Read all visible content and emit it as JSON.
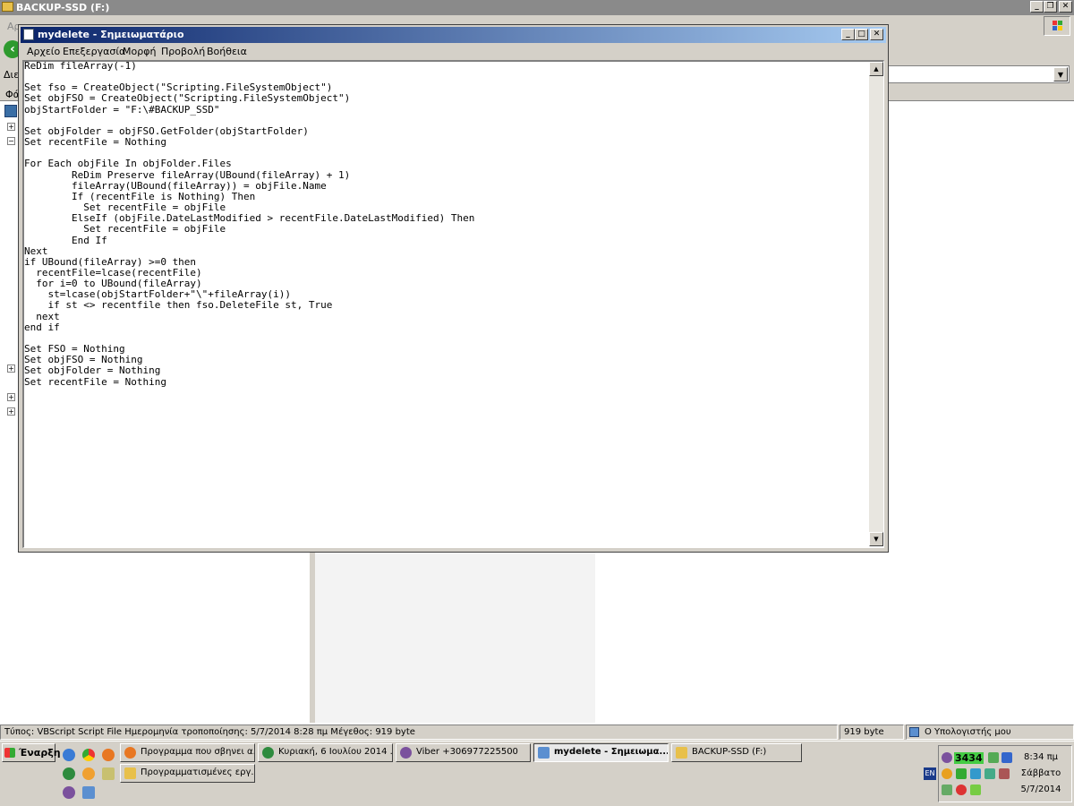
{
  "background_window": {
    "title": "BACKUP-SSD (F:)",
    "menu_partial": "Αρ",
    "address_label": "Διε",
    "pane_label": "Φά"
  },
  "notepad": {
    "title": "mydelete - Σημειωματάριο",
    "menu": [
      "Αρχείο",
      "Επεξεργασία",
      "Μορφή",
      "Προβολή",
      "Βοήθεια"
    ],
    "content": "ReDim fileArray(-1)\n\nSet fso = CreateObject(\"Scripting.FileSystemObject\")\nSet objFSO = CreateObject(\"Scripting.FileSystemObject\")\nobjStartFolder = \"F:\\#BACKUP_SSD\"\n\nSet objFolder = objFSO.GetFolder(objStartFolder)\nSet recentFile = Nothing\n\nFor Each objFile In objFolder.Files\n        ReDim Preserve fileArray(UBound(fileArray) + 1)\n        fileArray(UBound(fileArray)) = objFile.Name\n        If (recentFile is Nothing) Then\n          Set recentFile = objFile\n        ElseIf (objFile.DateLastModified > recentFile.DateLastModified) Then\n          Set recentFile = objFile\n        End If\nNext\nif UBound(fileArray) >=0 then\n  recentFile=lcase(recentFile)\n  for i=0 to UBound(fileArray)\n    st=lcase(objStartFolder+\"\\\"+fileArray(i))\n    if st <> recentfile then fso.DeleteFile st, True\n  next\nend if\n\nSet FSO = Nothing\nSet objFSO = Nothing\nSet objFolder = Nothing\nSet recentFile = Nothing\n"
  },
  "statusbar": {
    "info": "Τύπος: VBScript Script File Ημερομηνία τροποποίησης: 5/7/2014 8:28 πμ Μέγεθος: 919 byte",
    "size": "919 byte",
    "location": "Ο Υπολογιστής μου"
  },
  "taskbar": {
    "start_label": "Έναρξη",
    "tasks": [
      {
        "label": "Προγραμμα που σβηνει α...",
        "icon": "firefox-icon"
      },
      {
        "label": "Κυριακή, 6 Ιουλίου 2014 ...",
        "icon": "green-globe-icon"
      },
      {
        "label": "Viber +306977225500",
        "icon": "viber-icon"
      },
      {
        "label": "mydelete - Σημειωμα...",
        "icon": "notepad-icon",
        "active": true
      },
      {
        "label": "BACKUP-SSD (F:)",
        "icon": "folder-icon"
      },
      {
        "label": "Προγραμματισμένες εργ...",
        "icon": "folder-icon"
      }
    ],
    "lang": "EN",
    "tray_number": "3434",
    "clock": {
      "time": "8:34 πμ",
      "day": "Σάββατο",
      "date": "5/7/2014"
    }
  },
  "colors": {
    "titlebar_active": "#0a246a",
    "titlebar_gradient_end": "#a6caf0",
    "titlebar_inactive": "#8a8a8a",
    "chrome": "#d4d0c8"
  }
}
